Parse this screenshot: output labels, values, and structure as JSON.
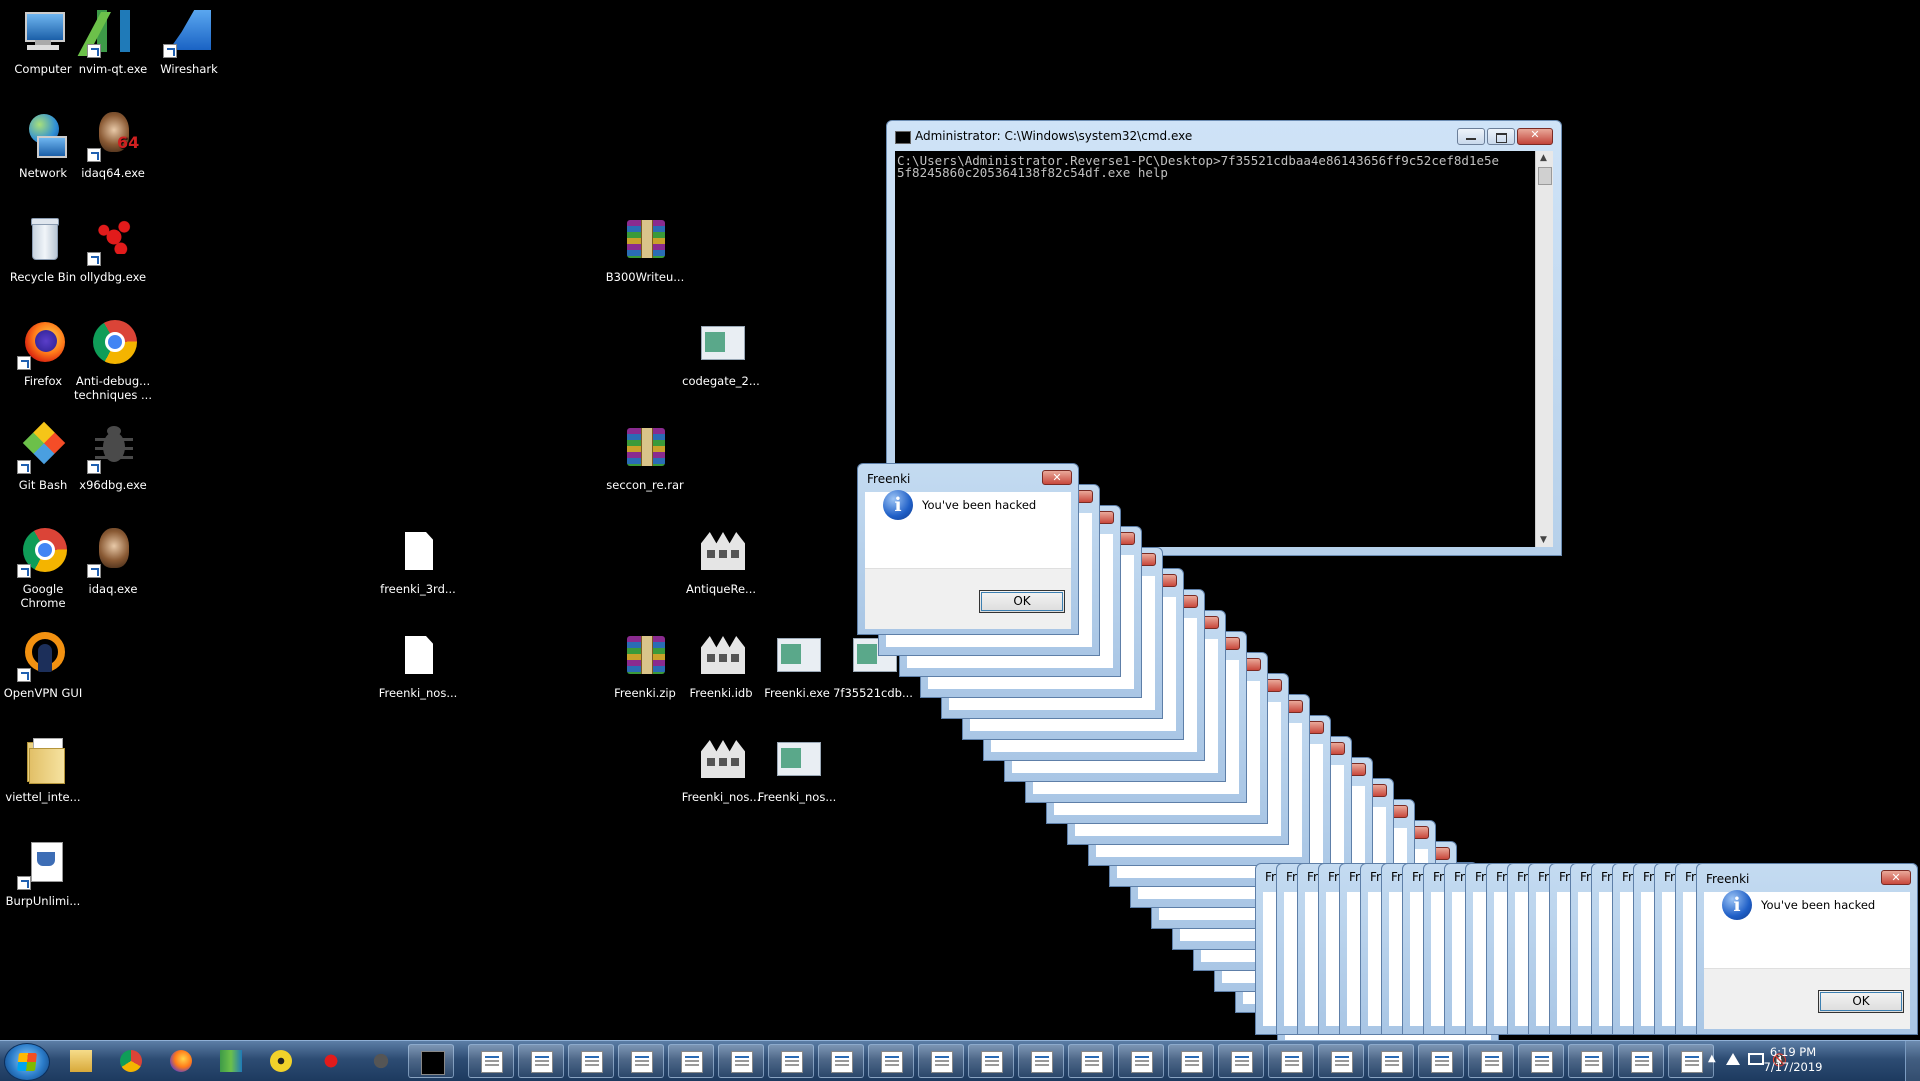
{
  "desktop": {
    "icons": [
      {
        "label": "Computer",
        "icon": "computer-icon"
      },
      {
        "label": "nvim-qt.exe",
        "icon": "neovim-icon"
      },
      {
        "label": "Wireshark",
        "icon": "wireshark-icon"
      },
      {
        "label": "Network",
        "icon": "network-icon"
      },
      {
        "label": "idaq64.exe",
        "icon": "ida64-icon"
      },
      {
        "label": "Recycle Bin",
        "icon": "recycle-bin-icon"
      },
      {
        "label": "ollydbg.exe",
        "icon": "ollydbg-icon"
      },
      {
        "label": "B300Writeu...",
        "icon": "winrar-archive-icon"
      },
      {
        "label": "Firefox",
        "icon": "firefox-icon"
      },
      {
        "label": "Anti-debug... techniques ...",
        "icon": "chrome-icon"
      },
      {
        "label": "codegate_2...",
        "icon": "window-app-icon"
      },
      {
        "label": "Git Bash",
        "icon": "git-bash-icon"
      },
      {
        "label": "x96dbg.exe",
        "icon": "x64dbg-icon"
      },
      {
        "label": "seccon_re.rar",
        "icon": "winrar-archive-icon"
      },
      {
        "label": "Google Chrome",
        "icon": "chrome-icon"
      },
      {
        "label": "idaq.exe",
        "icon": "ida-icon"
      },
      {
        "label": "freenki_3rd...",
        "icon": "blank-file-icon"
      },
      {
        "label": "AntiqueRe...",
        "icon": "ida-database-icon"
      },
      {
        "label": "OpenVPN GUI",
        "icon": "openvpn-icon"
      },
      {
        "label": "Freenki_nos...",
        "icon": "blank-file-icon"
      },
      {
        "label": "Freenki.zip",
        "icon": "winrar-archive-icon"
      },
      {
        "label": "Freenki.idb",
        "icon": "ida-database-icon"
      },
      {
        "label": "Freenki.exe",
        "icon": "window-app-icon"
      },
      {
        "label": "7f35521cdb...",
        "icon": "window-app-icon"
      },
      {
        "label": "viettel_inte...",
        "icon": "folder-icon"
      },
      {
        "label": "Freenki_nos...",
        "icon": "ida-database-icon"
      },
      {
        "label": "Freenki_nos...",
        "icon": "window-app-icon"
      },
      {
        "label": "BurpUnlimi...",
        "icon": "java-jar-icon"
      }
    ]
  },
  "cmd": {
    "title": "Administrator: C:\\Windows\\system32\\cmd.exe",
    "output": "C:\\Users\\Administrator.Reverse1-PC\\Desktop>7f35521cdbaa4e86143656ff9c52cef8d1e5e\n5f8245860c205364138f82c54df.exe help"
  },
  "dialog": {
    "title": "Freenki",
    "message": "You've been hacked",
    "ok_label": "OK",
    "ghost_title": "Freenki",
    "ghost_title_short": "Fr"
  },
  "taskbar": {
    "pinned": [
      "explorer-icon",
      "chrome-icon",
      "firefox-icon",
      "neovim-icon",
      "radiation-icon",
      "ollydbg-icon",
      "x64dbg-icon",
      "cmd-icon"
    ],
    "window_buttons_count": 25,
    "clock_time": "6:19 PM",
    "clock_date": "7/17/2019"
  },
  "colors": {
    "desktop_bg": "#000000",
    "aero_title": "#bcd4ee",
    "close_red": "#c8483c"
  }
}
